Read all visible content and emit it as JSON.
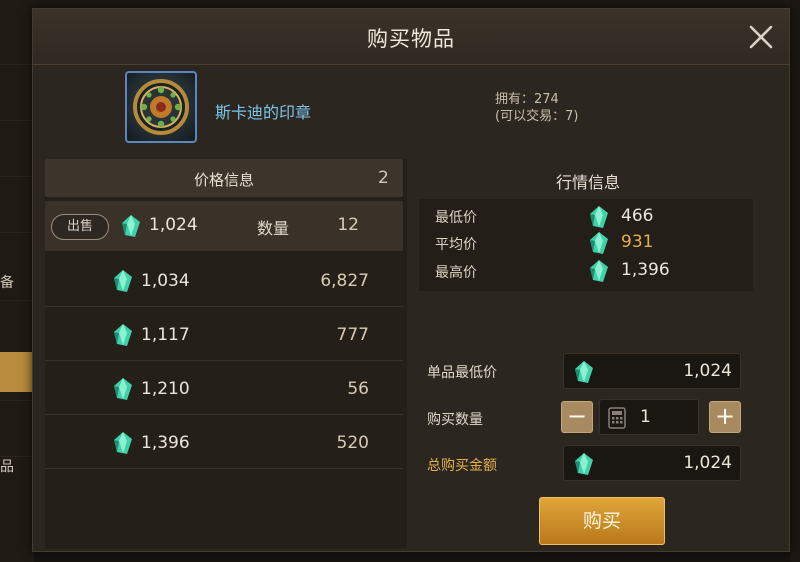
{
  "dialog": {
    "title": "购买物品",
    "close_icon": "close-icon"
  },
  "item": {
    "icon": "seal-icon",
    "name": "斯卡迪的印章",
    "owned_line1": "拥有：274",
    "owned_line2": "(可以交易：7)"
  },
  "price_info": {
    "header": "价格信息",
    "page": "2",
    "sell_label": "出售",
    "qty_label": "数量",
    "rows": [
      {
        "price": "1,024",
        "qty": "12"
      },
      {
        "price": "1,034",
        "qty": "6,827"
      },
      {
        "price": "1,117",
        "qty": "777"
      },
      {
        "price": "1,210",
        "qty": "56"
      },
      {
        "price": "1,396",
        "qty": "520"
      }
    ]
  },
  "market": {
    "title": "行情信息",
    "rows": [
      {
        "label": "最低价",
        "value": "466",
        "color": "#ece6da"
      },
      {
        "label": "平均价",
        "value": "931",
        "color": "#e3b14c"
      },
      {
        "label": "最高价",
        "value": "1,396",
        "color": "#ece6da"
      }
    ]
  },
  "purchase": {
    "unit_min_label": "单品最低价",
    "unit_min_value": "1,024",
    "qty_label": "购买数量",
    "qty_value": "1",
    "minus": "−",
    "plus": "+",
    "total_label": "总购买金额",
    "total_value": "1,024",
    "buy_label": "购买"
  },
  "background": {
    "left_labels": [
      "备",
      "品"
    ]
  },
  "colors": {
    "gem": "#3fd2a8",
    "accent_gold": "#e3b14c",
    "item_name": "#7cc5ea"
  }
}
